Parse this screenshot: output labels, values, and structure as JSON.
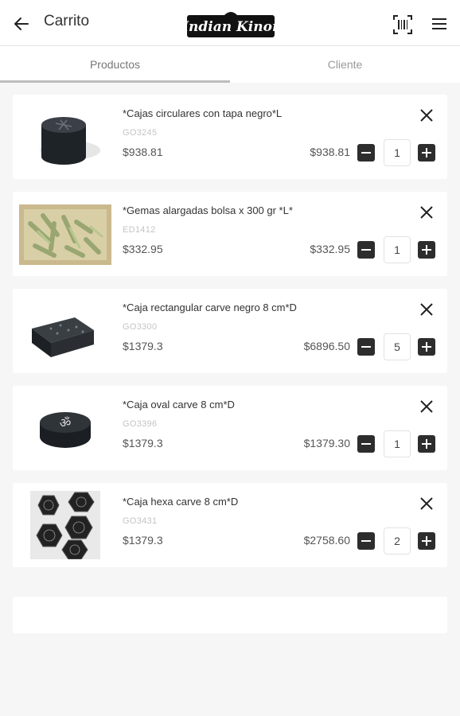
{
  "header": {
    "title": "Carrito",
    "brand": "Indian Kinor",
    "back_icon": "arrow-left-icon",
    "scan_icon": "barcode-scan-icon",
    "menu_icon": "hamburger-menu-icon"
  },
  "tabs": [
    {
      "label": "Productos",
      "active": true
    },
    {
      "label": "Cliente",
      "active": false
    }
  ],
  "colors": {
    "button": "#2d2d2d",
    "tab_indicator": "#bdbdbd",
    "sku": "#c4c4c4"
  },
  "cart": {
    "items": [
      {
        "name": "*Cajas circulares con tapa negro*L",
        "sku": "GO3245",
        "unit_price": "$938.81",
        "total": "$938.81",
        "qty": "1",
        "image": "round-black-box-with-lid"
      },
      {
        "name": "*Gemas alargadas bolsa x 300 gr *L*",
        "sku": "ED1412",
        "unit_price": "$332.95",
        "total": "$332.95",
        "qty": "1",
        "image": "elongated-green-gems"
      },
      {
        "name": "*Caja rectangular carve negro 8 cm*D",
        "sku": "GO3300",
        "unit_price": "$1379.3",
        "total": "$6896.50",
        "qty": "5",
        "image": "black-carved-rectangular-box"
      },
      {
        "name": "*Caja oval carve 8 cm*D",
        "sku": "GO3396",
        "unit_price": "$1379.3",
        "total": "$1379.30",
        "qty": "1",
        "image": "oval-box-om-symbol"
      },
      {
        "name": "*Caja hexa carve 8 cm*D",
        "sku": "GO3431",
        "unit_price": "$1379.3",
        "total": "$2758.60",
        "qty": "2",
        "image": "hexagonal-carved-boxes"
      }
    ]
  }
}
